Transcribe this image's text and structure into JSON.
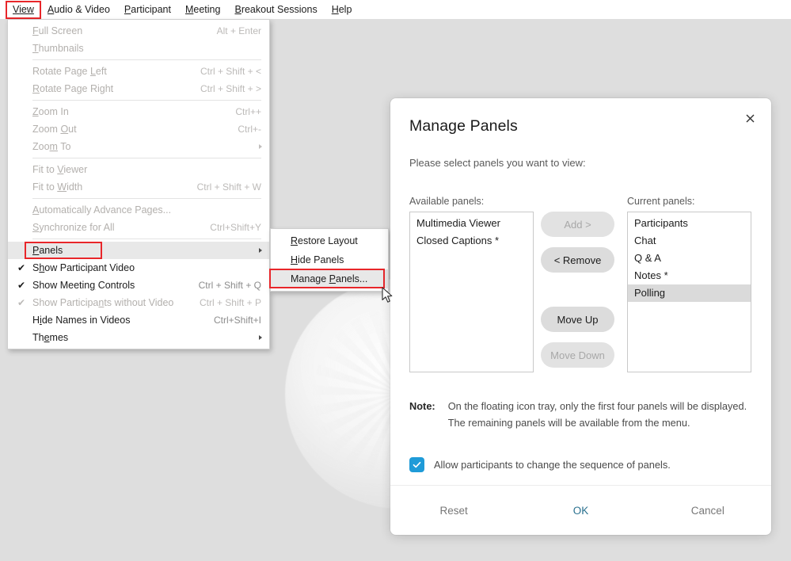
{
  "menubar": {
    "items": [
      {
        "label": "View",
        "accesskey": "V",
        "boxed": true
      },
      {
        "label": "Audio & Video",
        "accesskey": "A",
        "boxed": false
      },
      {
        "label": "Participant",
        "accesskey": "P",
        "boxed": false
      },
      {
        "label": "Meeting",
        "accesskey": "M",
        "boxed": false
      },
      {
        "label": "Breakout Sessions",
        "accesskey": "B",
        "boxed": false
      },
      {
        "label": "Help",
        "accesskey": "H",
        "boxed": false
      }
    ]
  },
  "view_menu": {
    "items": [
      {
        "label": "Full Screen",
        "accel": "Alt + Enter",
        "disabled": true,
        "check": false,
        "arrow": false,
        "highlight": false
      },
      {
        "label": "Thumbnails",
        "accel": "",
        "disabled": true,
        "check": false,
        "arrow": false,
        "highlight": false
      },
      {
        "separator": true
      },
      {
        "label": "Rotate Page Left",
        "accel": "Ctrl + Shift + <",
        "disabled": true,
        "check": false,
        "arrow": false,
        "highlight": false
      },
      {
        "label": "Rotate Page Right",
        "accel": "Ctrl + Shift + >",
        "disabled": true,
        "check": false,
        "arrow": false,
        "highlight": false
      },
      {
        "separator": true
      },
      {
        "label": "Zoom In",
        "accel": "Ctrl++",
        "disabled": true,
        "check": false,
        "arrow": false,
        "highlight": false
      },
      {
        "label": "Zoom Out",
        "accel": "Ctrl+-",
        "disabled": true,
        "check": false,
        "arrow": false,
        "highlight": false
      },
      {
        "label": "Zoom To",
        "accel": "",
        "disabled": true,
        "check": false,
        "arrow": true,
        "highlight": false
      },
      {
        "separator": true
      },
      {
        "label": "Fit to Viewer",
        "accel": "",
        "disabled": true,
        "check": false,
        "arrow": false,
        "highlight": false
      },
      {
        "label": "Fit to Width",
        "accel": "Ctrl + Shift + W",
        "disabled": true,
        "check": false,
        "arrow": false,
        "highlight": false
      },
      {
        "separator": true
      },
      {
        "label": "Automatically Advance Pages...",
        "accel": "",
        "disabled": true,
        "check": false,
        "arrow": false,
        "highlight": false
      },
      {
        "label": "Synchronize for All",
        "accel": "Ctrl+Shift+Y",
        "disabled": true,
        "check": false,
        "arrow": false,
        "highlight": false
      },
      {
        "separator": true
      },
      {
        "label": "Panels",
        "accel": "",
        "disabled": false,
        "check": false,
        "arrow": true,
        "highlight": true
      },
      {
        "label": "Show Participant Video",
        "accel": "",
        "disabled": false,
        "check": true,
        "arrow": false,
        "highlight": false
      },
      {
        "label": "Show Meeting Controls",
        "accel": "Ctrl + Shift + Q",
        "disabled": false,
        "check": true,
        "arrow": false,
        "highlight": false
      },
      {
        "label": "Show Participants without Video",
        "accel": "Ctrl + Shift + P",
        "disabled": true,
        "check": true,
        "arrow": false,
        "highlight": false
      },
      {
        "label": "Hide Names in Videos",
        "accel": "Ctrl+Shift+I",
        "disabled": false,
        "check": false,
        "arrow": false,
        "highlight": false
      },
      {
        "label": "Themes",
        "accel": "",
        "disabled": false,
        "check": false,
        "arrow": true,
        "highlight": false
      }
    ]
  },
  "panels_submenu": {
    "items": [
      {
        "label": "Restore Layout",
        "highlight": false
      },
      {
        "label": "Hide Panels",
        "highlight": false
      },
      {
        "label": "Manage Panels...",
        "highlight": true
      }
    ]
  },
  "dialog": {
    "title": "Manage Panels",
    "close_icon": "close-icon",
    "subtitle": "Please select panels you want to view:",
    "available_label": "Available panels:",
    "current_label": "Current panels:",
    "available_panels": [
      {
        "label": "Multimedia Viewer",
        "selected": false
      },
      {
        "label": "Closed Captions *",
        "selected": false
      }
    ],
    "current_panels": [
      {
        "label": "Participants",
        "selected": false
      },
      {
        "label": "Chat",
        "selected": false
      },
      {
        "label": "Q & A",
        "selected": false
      },
      {
        "label": "Notes *",
        "selected": false
      },
      {
        "label": "Polling",
        "selected": true
      }
    ],
    "buttons": {
      "add": {
        "label": "Add >",
        "disabled": true
      },
      "remove": {
        "label": "< Remove",
        "disabled": false
      },
      "move_up": {
        "label": "Move Up",
        "disabled": false
      },
      "move_down": {
        "label": "Move Down",
        "disabled": true
      }
    },
    "note_label": "Note:",
    "note_text": "On the floating icon tray, only the first four panels will be displayed. The remaining panels will be available from the menu.",
    "checkbox": {
      "label": "Allow participants to change the sequence of panels.",
      "checked": true
    },
    "footer": {
      "reset": "Reset",
      "ok": "OK",
      "cancel": "Cancel"
    }
  },
  "colors": {
    "accent_ok": "#2a718f",
    "checkbox_blue": "#1f9bd8",
    "highlight_red": "#e8262a",
    "selection_gray": "#dadada",
    "desktop_gray": "#dedede"
  }
}
